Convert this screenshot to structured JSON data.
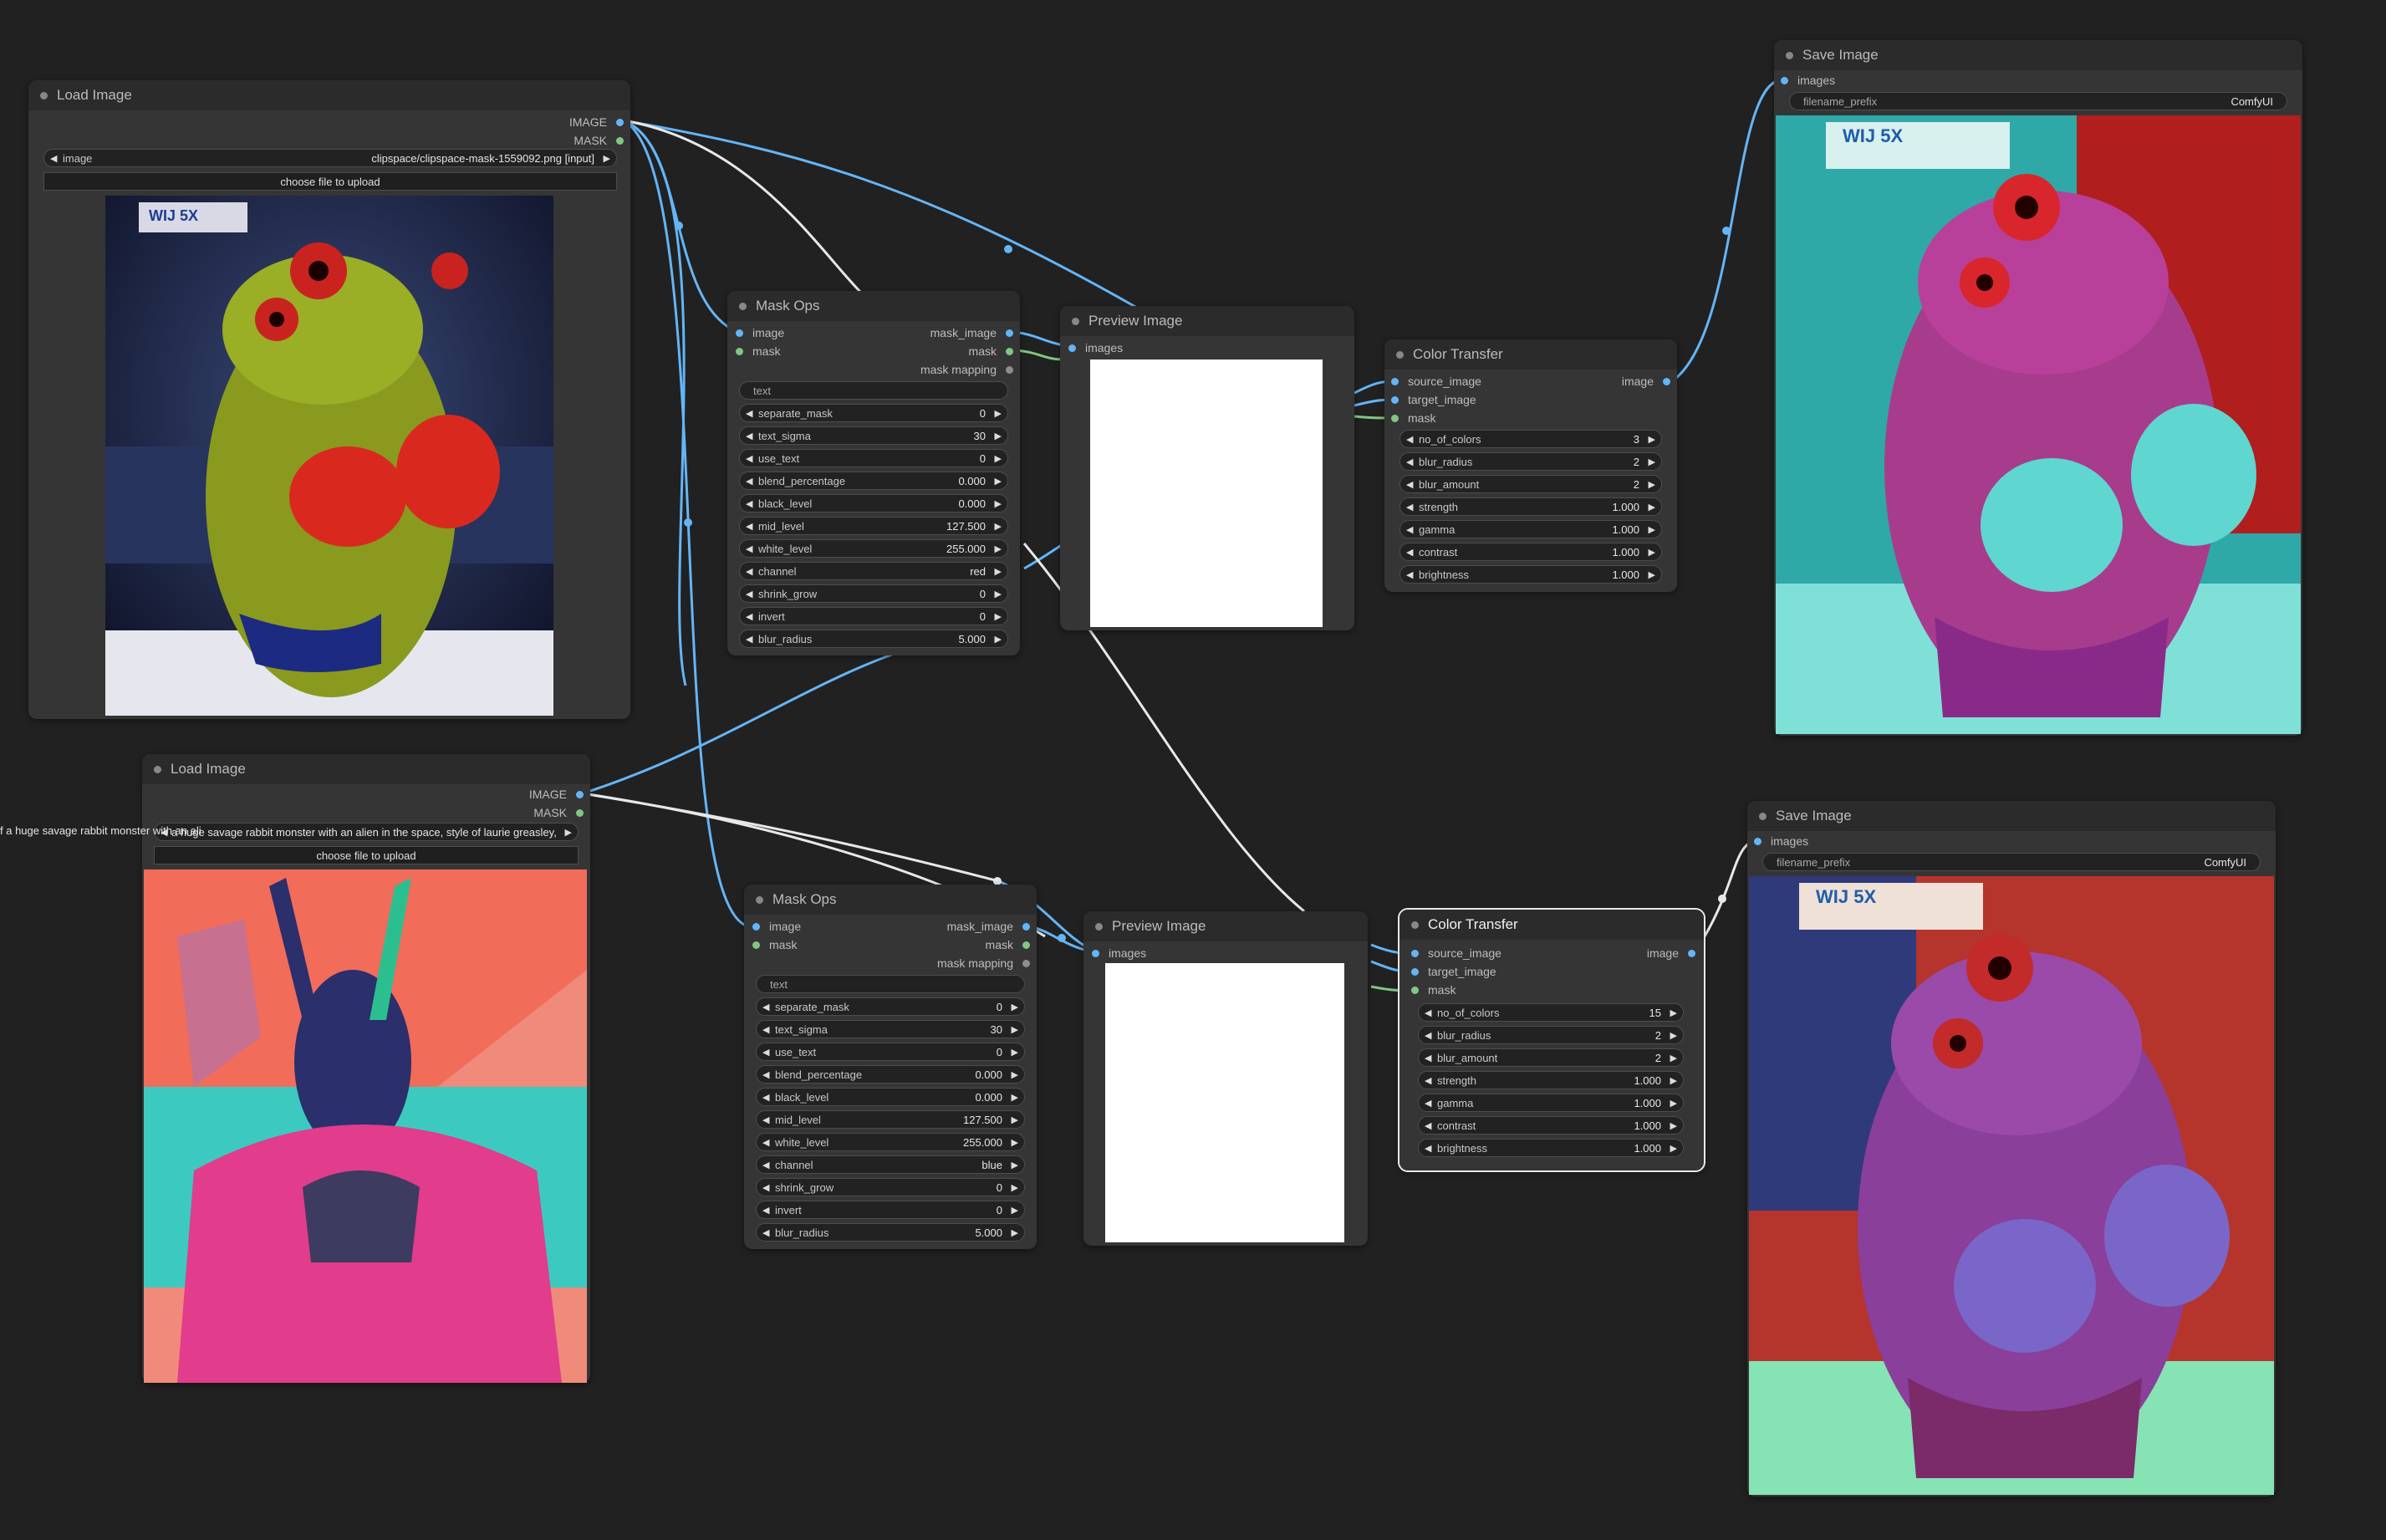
{
  "nodes": {
    "load1": {
      "title": "Load Image",
      "out_image": "IMAGE",
      "out_mask": "MASK",
      "image_label": "image",
      "image_value": "clipspace/clipspace-mask-1559092.png [input]",
      "upload": "choose file to upload"
    },
    "load2": {
      "title": "Load Image",
      "out_image": "IMAGE",
      "out_mask": "MASK",
      "image_label": "image",
      "image_value": "a huge savage rabbit monster with an alien in the space, style of laurie greasley, studio ghibli, akira toriy.png",
      "overflow_text": "f a huge savage rabbit monster with an alien in the space, style of laurie greasley, studio ghibli, akira toriy.png",
      "upload": "choose file to upload"
    },
    "mask1": {
      "title": "Mask Ops",
      "in_image": "image",
      "in_mask": "mask",
      "out_mask_image": "mask_image",
      "out_mask": "mask",
      "out_mapping": "mask mapping",
      "text_placeholder": "text",
      "params": [
        {
          "label": "separate_mask",
          "value": "0"
        },
        {
          "label": "text_sigma",
          "value": "30"
        },
        {
          "label": "use_text",
          "value": "0"
        },
        {
          "label": "blend_percentage",
          "value": "0.000"
        },
        {
          "label": "black_level",
          "value": "0.000"
        },
        {
          "label": "mid_level",
          "value": "127.500"
        },
        {
          "label": "white_level",
          "value": "255.000"
        },
        {
          "label": "channel",
          "value": "red"
        },
        {
          "label": "shrink_grow",
          "value": "0"
        },
        {
          "label": "invert",
          "value": "0"
        },
        {
          "label": "blur_radius",
          "value": "5.000"
        }
      ]
    },
    "mask2": {
      "title": "Mask Ops",
      "in_image": "image",
      "in_mask": "mask",
      "out_mask_image": "mask_image",
      "out_mask": "mask",
      "out_mapping": "mask mapping",
      "text_placeholder": "text",
      "params": [
        {
          "label": "separate_mask",
          "value": "0"
        },
        {
          "label": "text_sigma",
          "value": "30"
        },
        {
          "label": "use_text",
          "value": "0"
        },
        {
          "label": "blend_percentage",
          "value": "0.000"
        },
        {
          "label": "black_level",
          "value": "0.000"
        },
        {
          "label": "mid_level",
          "value": "127.500"
        },
        {
          "label": "white_level",
          "value": "255.000"
        },
        {
          "label": "channel",
          "value": "blue"
        },
        {
          "label": "shrink_grow",
          "value": "0"
        },
        {
          "label": "invert",
          "value": "0"
        },
        {
          "label": "blur_radius",
          "value": "5.000"
        }
      ]
    },
    "preview1": {
      "title": "Preview Image",
      "in_images": "images"
    },
    "preview2": {
      "title": "Preview Image",
      "in_images": "images"
    },
    "ct1": {
      "title": "Color Transfer",
      "in_source": "source_image",
      "in_target": "target_image",
      "in_mask": "mask",
      "out_image": "image",
      "params": [
        {
          "label": "no_of_colors",
          "value": "3"
        },
        {
          "label": "blur_radius",
          "value": "2"
        },
        {
          "label": "blur_amount",
          "value": "2"
        },
        {
          "label": "strength",
          "value": "1.000"
        },
        {
          "label": "gamma",
          "value": "1.000"
        },
        {
          "label": "contrast",
          "value": "1.000"
        },
        {
          "label": "brightness",
          "value": "1.000"
        }
      ]
    },
    "ct2": {
      "title": "Color Transfer",
      "in_source": "source_image",
      "in_target": "target_image",
      "in_mask": "mask",
      "out_image": "image",
      "params": [
        {
          "label": "no_of_colors",
          "value": "15"
        },
        {
          "label": "blur_radius",
          "value": "2"
        },
        {
          "label": "blur_amount",
          "value": "2"
        },
        {
          "label": "strength",
          "value": "1.000"
        },
        {
          "label": "gamma",
          "value": "1.000"
        },
        {
          "label": "contrast",
          "value": "1.000"
        },
        {
          "label": "brightness",
          "value": "1.000"
        }
      ]
    },
    "save1": {
      "title": "Save Image",
      "in_images": "images",
      "prefix_label": "filename_prefix",
      "prefix_value": "ComfyUI",
      "banner_text": "WIJ 5X"
    },
    "save2": {
      "title": "Save Image",
      "in_images": "images",
      "prefix_label": "filename_prefix",
      "prefix_value": "ComfyUI",
      "banner_text": "WIJ 5X"
    }
  },
  "images": {
    "frog_banner": "WIJ 5X"
  },
  "colors": {
    "canvas": "#212121",
    "node_bg": "#353535",
    "image_link": "#64b5f6",
    "mask_link": "#81c784",
    "wire_white": "#e8e8e8"
  }
}
